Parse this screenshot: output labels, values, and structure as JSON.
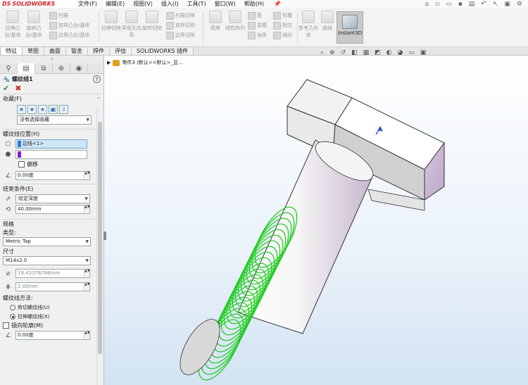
{
  "app": {
    "logo_ds": "DS",
    "logo_text": "SOLIDWORKS"
  },
  "menu": [
    "文件(F)",
    "编辑(E)",
    "视图(V)",
    "插入(I)",
    "工具(T)",
    "窗口(W)",
    "帮助(H)"
  ],
  "ribbon": {
    "big": [
      {
        "label": "拉伸凸台/基体"
      },
      {
        "label": "旋转凸台/基体"
      },
      {
        "label": "拉伸切除"
      },
      {
        "label": "异型孔向导"
      },
      {
        "label": "旋转切除"
      },
      {
        "label": "圆角"
      },
      {
        "label": "线性阵列"
      },
      {
        "label": "参考几何体"
      },
      {
        "label": "曲线"
      }
    ],
    "small_a": [
      "扫描",
      "放样凸台/基体",
      "边界凸台/基体"
    ],
    "small_b": [
      "扫描切除",
      "放样切割",
      "边界切除"
    ],
    "small_c": [
      "筋",
      "拔模",
      "抽壳"
    ],
    "small_d": [
      "包覆",
      "相交",
      "镜向"
    ],
    "instant3d": "Instant3D"
  },
  "tabs": [
    "特征",
    "草图",
    "曲面",
    "钣金",
    "焊件",
    "评估",
    "SOLIDWORKS 插件"
  ],
  "active_tab": "特征",
  "tree": {
    "label": "零件3 (默认<<默认>_显..."
  },
  "panel": {
    "title": "螺纹线1",
    "help": "?",
    "favorites": {
      "header": "收藏(F)",
      "select": "没有选择收藏"
    },
    "location": {
      "header": "螺纹线位置(H)",
      "edge": "边线<1>",
      "offset_label": "偏移",
      "angle": "0.00度"
    },
    "end": {
      "header": "结束条件(E)",
      "type": "给定深度",
      "depth": "40.00mm"
    },
    "spec": {
      "header": "规格",
      "type_label": "类型:",
      "type": "Metric Tap",
      "size_label": "尺寸",
      "size": "M14x2.0",
      "diameter": "19.43376786mm",
      "pitch": "2.00mm"
    },
    "method": {
      "label": "螺纹线方法:",
      "options": [
        {
          "label": "剪切螺纹线(U)",
          "checked": false
        },
        {
          "label": "拉伸螺纹线(X)",
          "checked": true
        }
      ]
    },
    "mirror": {
      "label": "镜向轮廓(M)"
    },
    "bottom_angle": "0.00度"
  },
  "colors": {
    "thread": "#22cc22",
    "accent": "#2f7ed0",
    "purple": "#8a1ed6"
  }
}
